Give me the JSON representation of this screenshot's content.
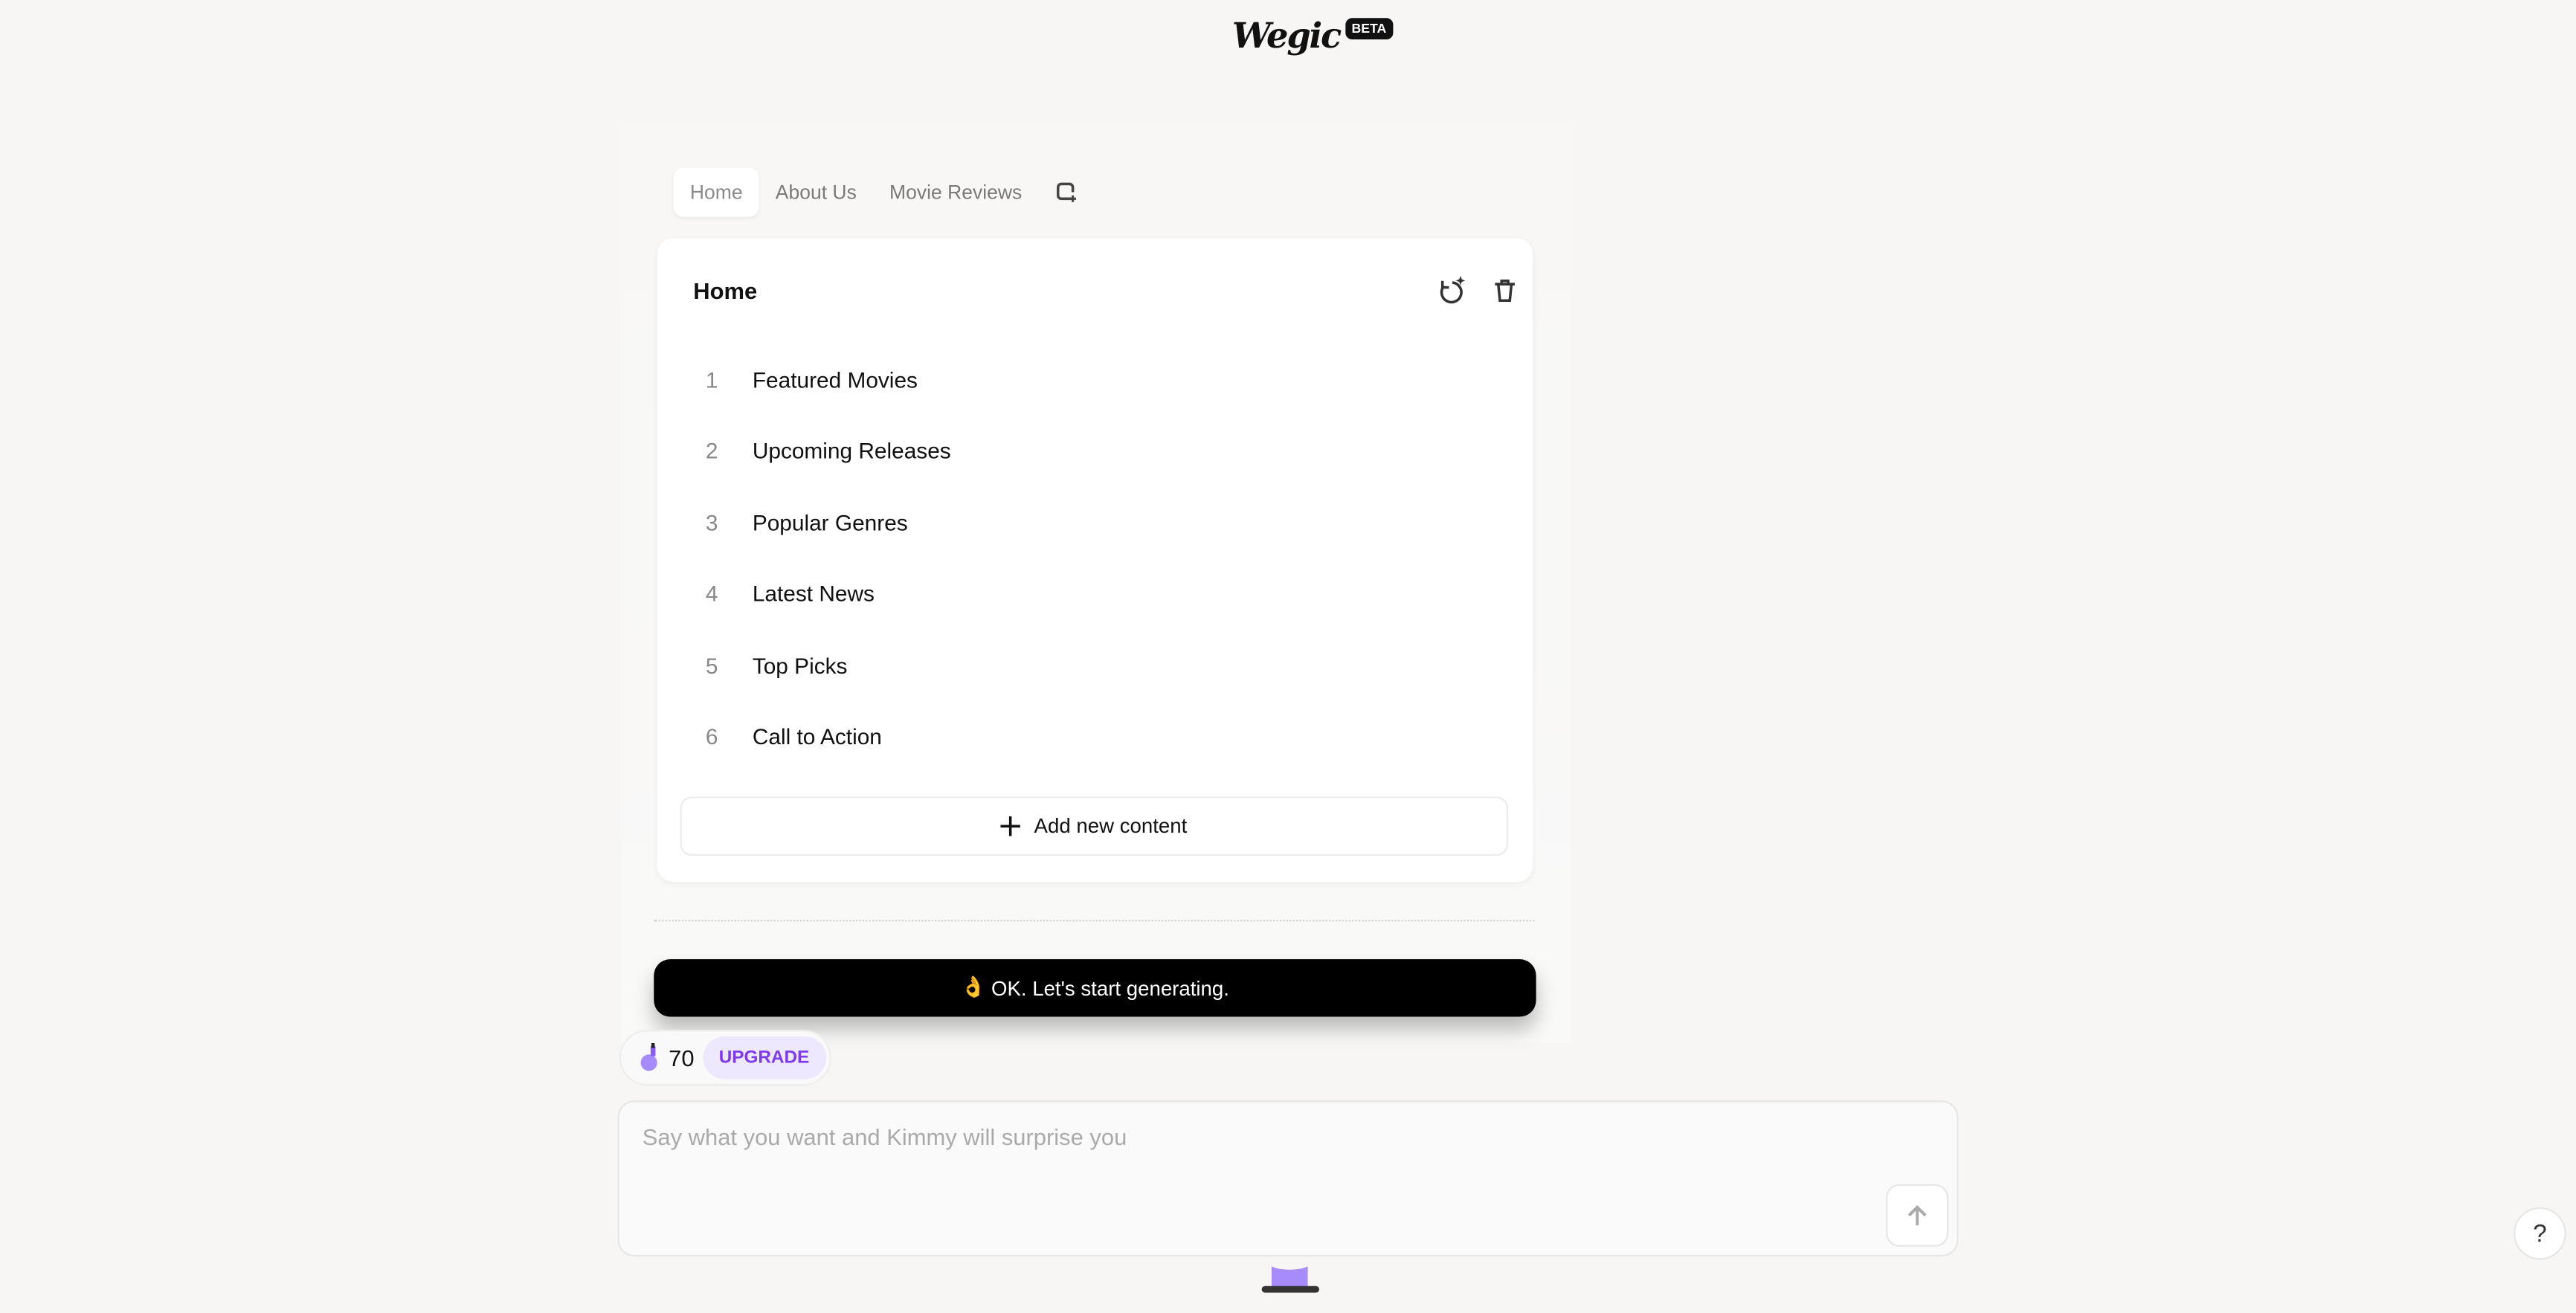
{
  "logo": {
    "word": "Wegic",
    "badge": "BETA"
  },
  "tabs": [
    {
      "label": "Home",
      "active": true
    },
    {
      "label": "About Us",
      "active": false
    },
    {
      "label": "Movie Reviews",
      "active": false
    }
  ],
  "card": {
    "title": "Home",
    "items": [
      {
        "num": "1",
        "label": "Featured Movies"
      },
      {
        "num": "2",
        "label": "Upcoming Releases"
      },
      {
        "num": "3",
        "label": "Popular Genres"
      },
      {
        "num": "4",
        "label": "Latest News"
      },
      {
        "num": "5",
        "label": "Top Picks"
      },
      {
        "num": "6",
        "label": "Call to Action"
      }
    ],
    "add_label": "Add new content"
  },
  "generate_button": {
    "emoji": "👌",
    "label": "OK. Let's start generating."
  },
  "credits": {
    "count": "70",
    "upgrade_label": "UPGRADE"
  },
  "chat": {
    "placeholder": "Say what you want and Kimmy will surprise you",
    "value": ""
  },
  "help_label": "?",
  "colors": {
    "accent": "#7c3aed",
    "upgrade_bg": "#ede8fd",
    "button": "#000000"
  }
}
